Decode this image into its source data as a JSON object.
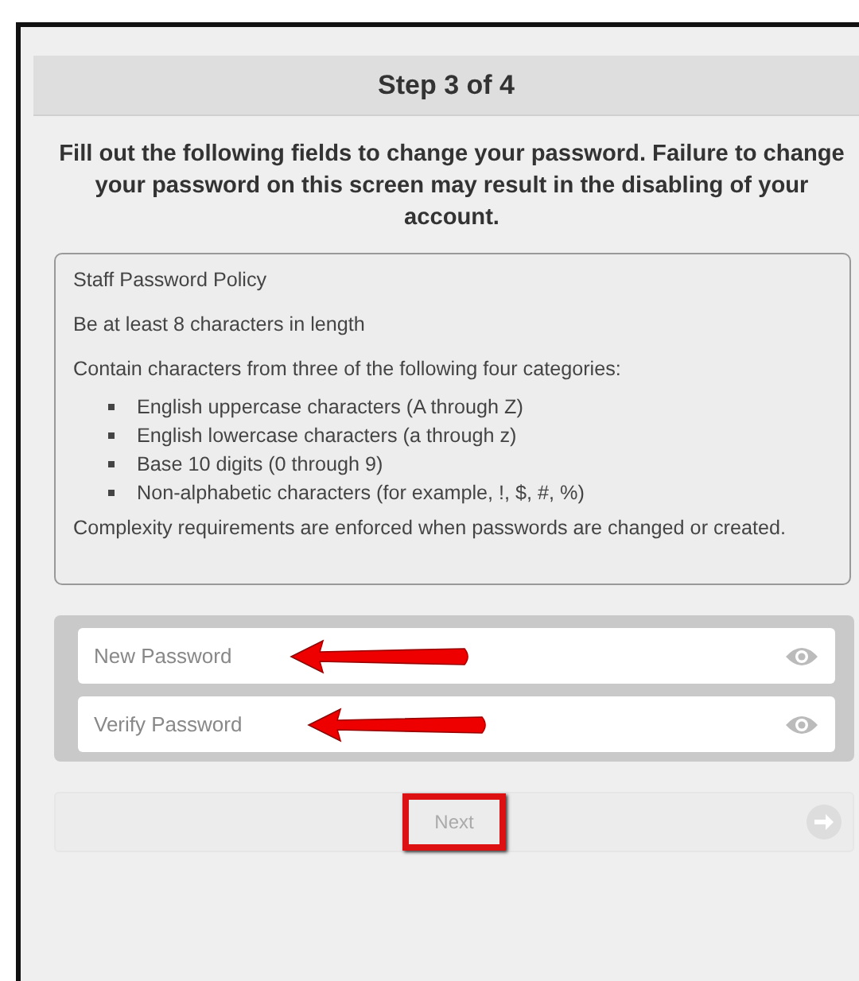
{
  "header": {
    "title": "Step 3 of 4"
  },
  "instructions": "Fill out the following fields to change your password. Failure to change your password on this screen may result in the disabling of your account.",
  "policy": {
    "title": "Staff Password Policy",
    "length_rule": "Be at least 8 characters in length",
    "categories_intro": "Contain characters from three of the following four categories:",
    "categories": [
      "English uppercase characters (A through Z)",
      "English lowercase characters (a through z)",
      "Base 10 digits (0 through 9)",
      "Non-alphabetic characters (for example, !, $, #, %)"
    ],
    "note": "Complexity requirements are enforced when passwords are changed or created."
  },
  "fields": [
    {
      "placeholder": "New Password",
      "highlighted": true
    },
    {
      "placeholder": "Verify Password",
      "highlighted": true
    }
  ],
  "next_button": {
    "label": "Next",
    "disabled": true,
    "highlighted": true
  }
}
